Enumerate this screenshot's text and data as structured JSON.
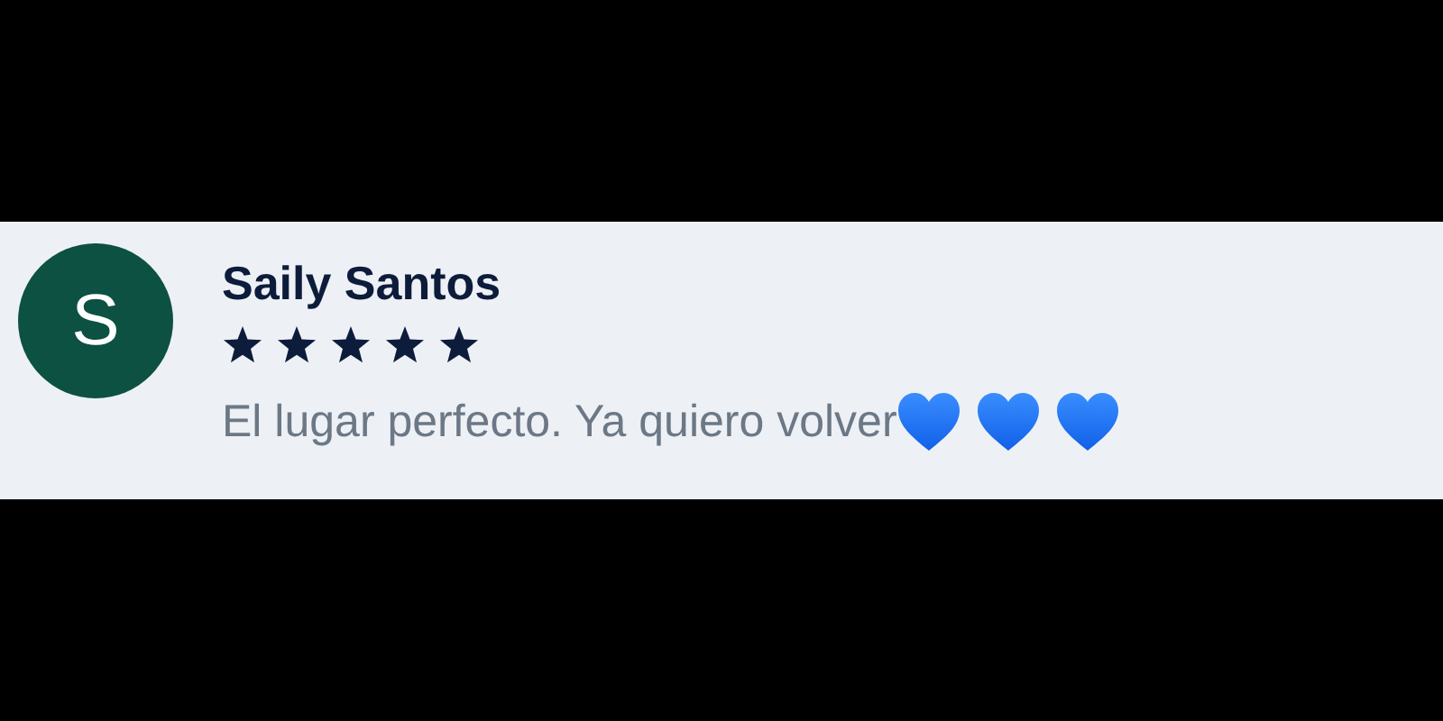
{
  "review": {
    "avatar_letter": "S",
    "name": "Saily Santos",
    "stars": 5,
    "comment": "El lugar perfecto. Ya quiero volver",
    "reaction_icons": [
      {
        "kind": "heart"
      },
      {
        "kind": "heart"
      },
      {
        "kind": "heart"
      }
    ]
  }
}
